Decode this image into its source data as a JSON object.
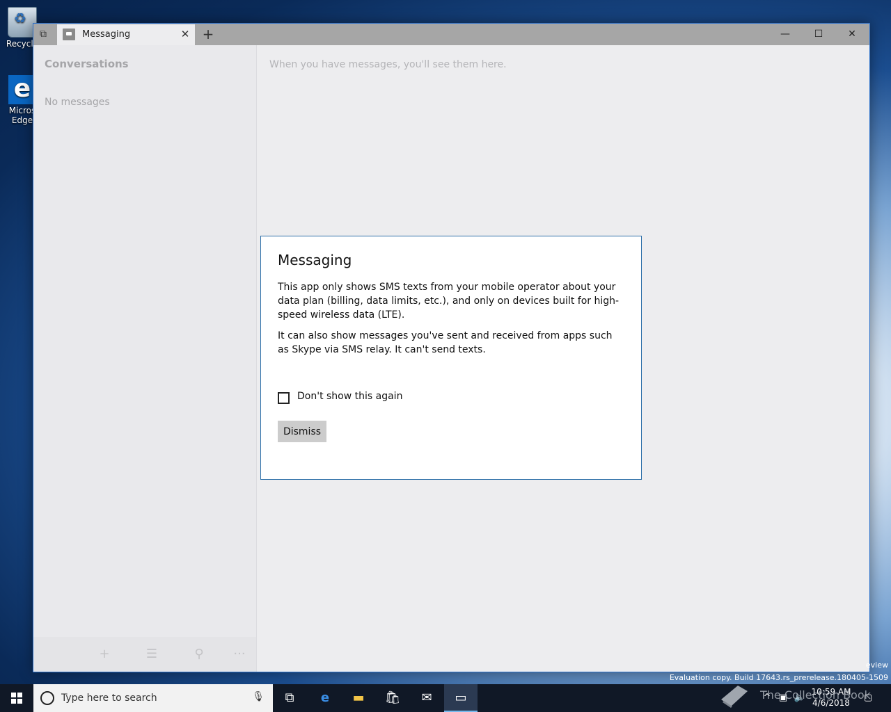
{
  "desktop": {
    "icons": [
      {
        "label": "Recycle"
      },
      {
        "label": "Micros Edge"
      }
    ]
  },
  "window": {
    "tab_title": "Messaging",
    "minimize": "—",
    "maximize": "☐",
    "close": "✕"
  },
  "sidebar": {
    "title": "Conversations",
    "empty_text": "No messages"
  },
  "main": {
    "hint": "When you have messages, you'll see them here."
  },
  "dialog": {
    "title": "Messaging",
    "paragraph1": "This app only shows SMS texts from your mobile operator about your data plan (billing, data limits, etc.), and only on devices built for high-speed wireless data (LTE).",
    "paragraph2": "It can also show messages you've sent and received from apps such as Skype via SMS relay. It can't send texts.",
    "checkbox_label": "Don't show this again",
    "checkbox_checked": false,
    "dismiss_label": "Dismiss"
  },
  "watermark": {
    "line1": "eview",
    "line2": "Evaluation copy. Build 17643.rs_prerelease.180405-1509",
    "overlay": "The Collection Book"
  },
  "taskbar": {
    "search_placeholder": "Type here to search",
    "apps": [
      "task-view-icon",
      "edge-icon",
      "file-explorer-icon",
      "store-icon",
      "mail-icon",
      "messaging-icon"
    ],
    "clock_time": "10:59 AM",
    "clock_date": "4/6/2018"
  },
  "colors": {
    "accent": "#2b6ea8",
    "titlebar": "#a6a6a6",
    "taskbar": "#101826"
  }
}
